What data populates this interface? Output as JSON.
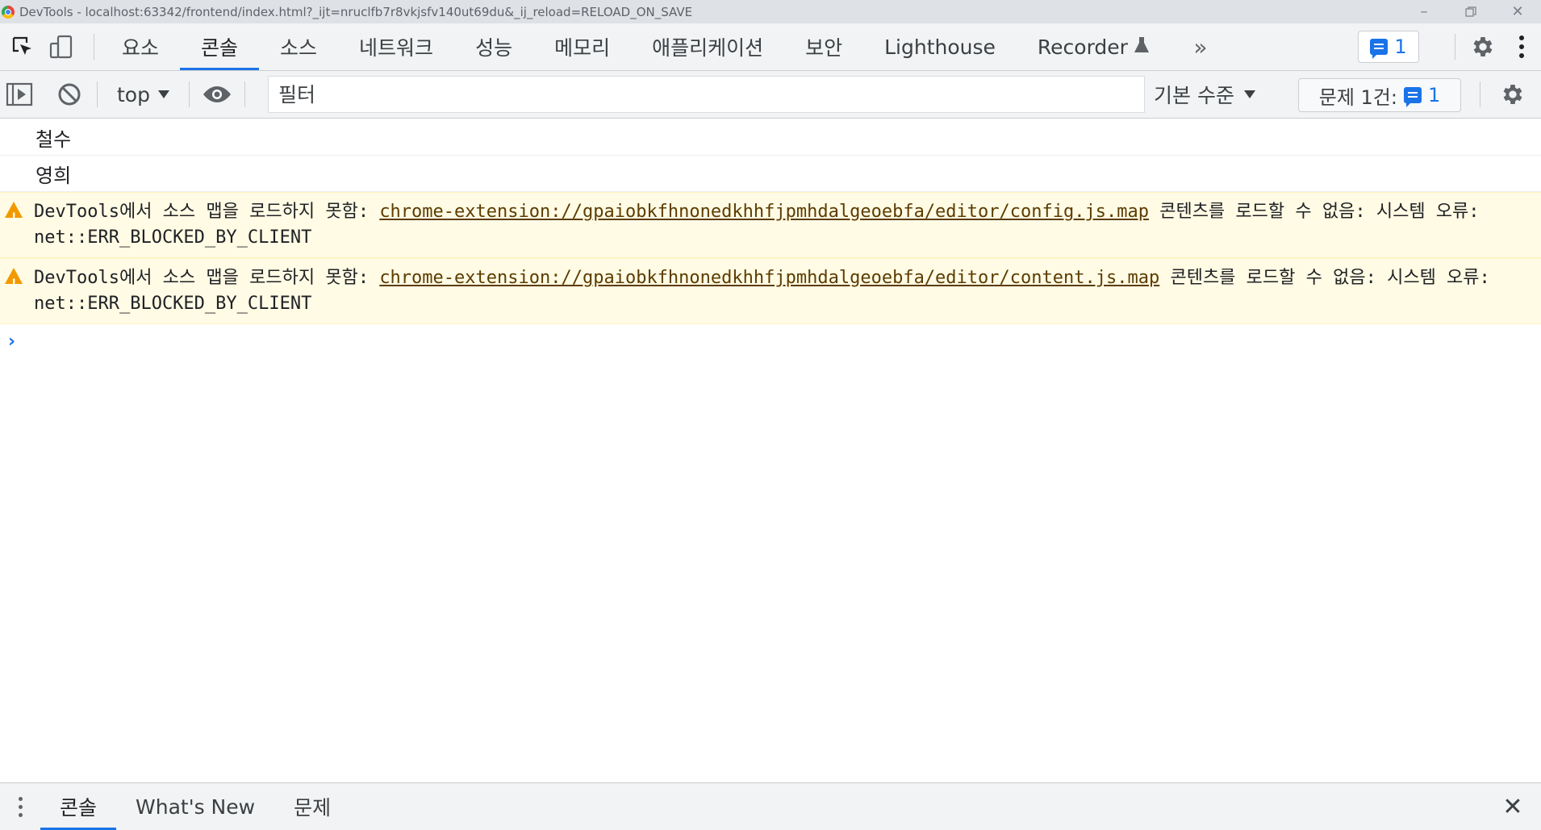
{
  "window": {
    "title": "DevTools - localhost:63342/frontend/index.html?_ijt=nruclfb7r8vkjsfv140ut69du&_ij_reload=RELOAD_ON_SAVE"
  },
  "tabs": [
    {
      "label": "요소"
    },
    {
      "label": "콘솔",
      "active": true
    },
    {
      "label": "소스"
    },
    {
      "label": "네트워크"
    },
    {
      "label": "성능"
    },
    {
      "label": "메모리"
    },
    {
      "label": "애플리케이션"
    },
    {
      "label": "보안"
    },
    {
      "label": "Lighthouse"
    },
    {
      "label": "Recorder"
    }
  ],
  "issues_badge": {
    "count": "1"
  },
  "toolbar": {
    "context": "top",
    "filter_placeholder": "필터",
    "levels": "기본 수준",
    "issues_label": "문제 1건:",
    "issues_count": "1"
  },
  "console": {
    "logs": [
      "철수",
      "영희"
    ],
    "warnings": [
      {
        "prefix": "DevTools에서 소스 맵을 로드하지 못함: ",
        "url": "chrome-extension://gpaiobkfhnonedkhhfjpmhdalgeoebfa/editor/config.js.map",
        "suffix": " 콘텐츠를 로드할 수 없음: 시스템 오류: net::ERR_BLOCKED_BY_CLIENT"
      },
      {
        "prefix": "DevTools에서 소스 맵을 로드하지 못함: ",
        "url": "chrome-extension://gpaiobkfhnonedkhhfjpmhdalgeoebfa/editor/content.js.map",
        "suffix": " 콘텐츠를 로드할 수 없음: 시스템 오류: net::ERR_BLOCKED_BY_CLIENT"
      }
    ]
  },
  "drawer": {
    "tabs": [
      {
        "label": "콘솔",
        "active": true
      },
      {
        "label": "What's New"
      },
      {
        "label": "문제"
      }
    ]
  },
  "colors": {
    "accent": "#1a73e8",
    "warning_bg": "#fffbe5",
    "warning_icon": "#f29900"
  }
}
